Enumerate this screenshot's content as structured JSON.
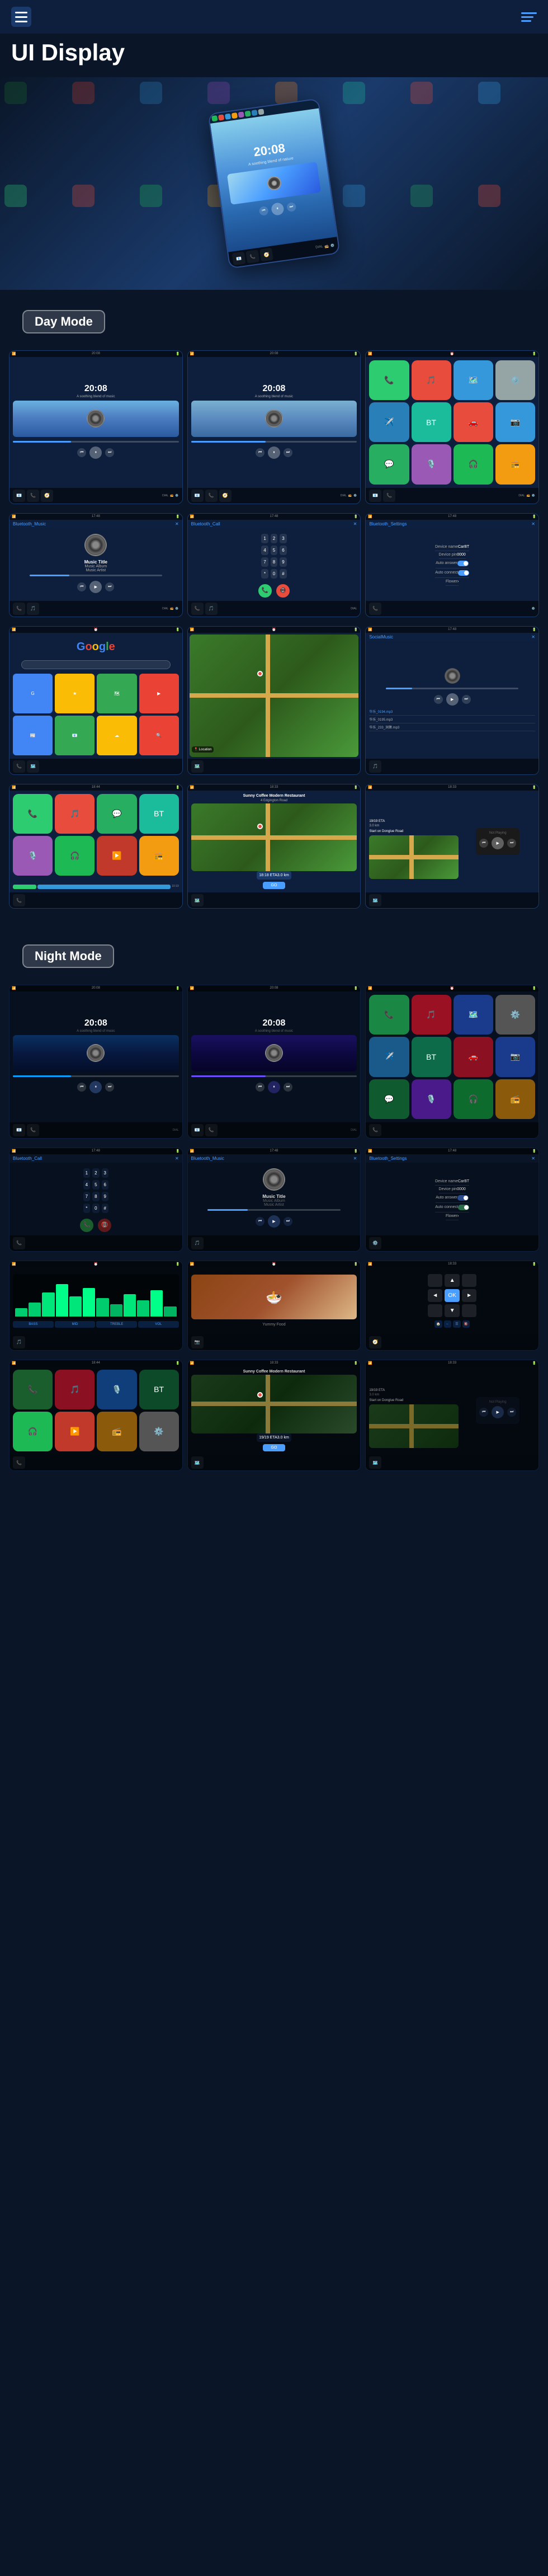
{
  "header": {
    "title": "UI Display",
    "menu_icon_label": "menu",
    "lines_icon_label": "lines"
  },
  "hero": {
    "device_time": "20:08",
    "device_subtitle": "A soothing blend of nature"
  },
  "day_mode": {
    "label": "Day Mode",
    "screens": [
      {
        "id": "day-music-1",
        "type": "music",
        "time": "20:08",
        "subtitle": "A soothing blend of music"
      },
      {
        "id": "day-music-2",
        "type": "music",
        "time": "20:08",
        "subtitle": "A soothing blend of music"
      },
      {
        "id": "day-apps",
        "type": "apps"
      },
      {
        "id": "day-bt-music",
        "type": "bt_music",
        "title": "Bluetooth_Music",
        "track_title": "Music Title",
        "album": "Music Album",
        "artist": "Music Artist"
      },
      {
        "id": "day-bt-call",
        "type": "bt_call",
        "title": "Bluetooth_Call"
      },
      {
        "id": "day-bt-settings",
        "type": "bt_settings",
        "title": "Bluetooth_Settings",
        "device_name_label": "Device name",
        "device_name_value": "CarBT",
        "device_pin_label": "Device pin",
        "device_pin_value": "0000",
        "auto_answer_label": "Auto answer",
        "auto_connect_label": "Auto connect",
        "flower_label": "Flower"
      },
      {
        "id": "day-google",
        "type": "google"
      },
      {
        "id": "day-map",
        "type": "map"
      },
      {
        "id": "day-social",
        "type": "social_music",
        "songs": [
          "华乐_0194.mp3",
          "华乐_0195.mp3",
          "华乐_233_洞箫.mp3"
        ]
      },
      {
        "id": "day-car-apps",
        "type": "car_apps"
      },
      {
        "id": "day-nav",
        "type": "navigation",
        "restaurant": "Sunny Coffee Modern Restaurant",
        "address": "4 Edgington Road",
        "eta": "18:18 ETA",
        "distance": "3.0 km",
        "go_label": "GO"
      },
      {
        "id": "day-nav-wide",
        "type": "navigation_wide",
        "speed": "19/19 ETA",
        "distance": "3.0 km",
        "instruction": "Start on Donglue Road",
        "not_playing": "Not Playing"
      }
    ]
  },
  "night_mode": {
    "label": "Night Mode",
    "screens": [
      {
        "id": "night-music-1",
        "type": "music_night",
        "time": "20:08"
      },
      {
        "id": "night-music-2",
        "type": "music_night",
        "time": "20:08"
      },
      {
        "id": "night-apps",
        "type": "apps_night"
      },
      {
        "id": "night-bt-call",
        "type": "bt_call_night",
        "title": "Bluetooth_Call"
      },
      {
        "id": "night-bt-music",
        "type": "bt_music_night",
        "title": "Bluetooth_Music",
        "track_title": "Music Title",
        "album": "Music Album",
        "artist": "Music Artist"
      },
      {
        "id": "night-bt-settings",
        "type": "bt_settings_night",
        "title": "Bluetooth_Settings",
        "device_name_label": "Device name",
        "device_name_value": "CarBT",
        "device_pin_label": "Device pin",
        "device_pin_value": "0000",
        "auto_answer_label": "Auto answer",
        "auto_connect_label": "Auto connect",
        "flower_label": "Flower"
      },
      {
        "id": "night-eq",
        "type": "equalizer"
      },
      {
        "id": "night-food",
        "type": "food_image"
      },
      {
        "id": "night-nav-arrows",
        "type": "nav_arrows"
      },
      {
        "id": "night-car-apps",
        "type": "car_apps_night"
      },
      {
        "id": "night-nav",
        "type": "navigation_night",
        "restaurant": "Sunny Coffee Modern Restaurant",
        "eta": "19/19 ETA",
        "distance": "3.0 km",
        "go_label": "GO"
      },
      {
        "id": "night-nav-wide",
        "type": "nav_wide_night",
        "speed": "19/19 ETA",
        "distance": "3.0 km",
        "instruction": "Start on Donglue Road",
        "not_playing": "Not Playing"
      }
    ]
  },
  "footer_nav": {
    "items": [
      "📞",
      "🎵",
      "🗺️",
      "⚙️",
      "📻",
      "BT"
    ]
  },
  "bt_keys": [
    [
      "1",
      "2",
      "3"
    ],
    [
      "4",
      "5",
      "6"
    ],
    [
      "7",
      "8",
      "9"
    ],
    [
      "*",
      "0",
      "#"
    ]
  ],
  "app_icons_day": [
    {
      "color": "#2ecc71",
      "icon": "📞"
    },
    {
      "color": "#e74c3c",
      "icon": "🎵"
    },
    {
      "color": "#3498db",
      "icon": "🗺️"
    },
    {
      "color": "#27ae60",
      "icon": "💬"
    },
    {
      "color": "#9b59b6",
      "icon": "🎙️"
    },
    {
      "color": "#e74c3c",
      "icon": "▶️"
    },
    {
      "color": "#1db954",
      "icon": "🎧"
    },
    {
      "color": "#f39c12",
      "icon": "📻"
    },
    {
      "color": "#2980b9",
      "icon": "✈️"
    },
    {
      "color": "#e74c3c",
      "icon": "❤️"
    },
    {
      "color": "#1abc9c",
      "icon": "BT"
    },
    {
      "color": "#3498db",
      "icon": "🚗"
    }
  ]
}
